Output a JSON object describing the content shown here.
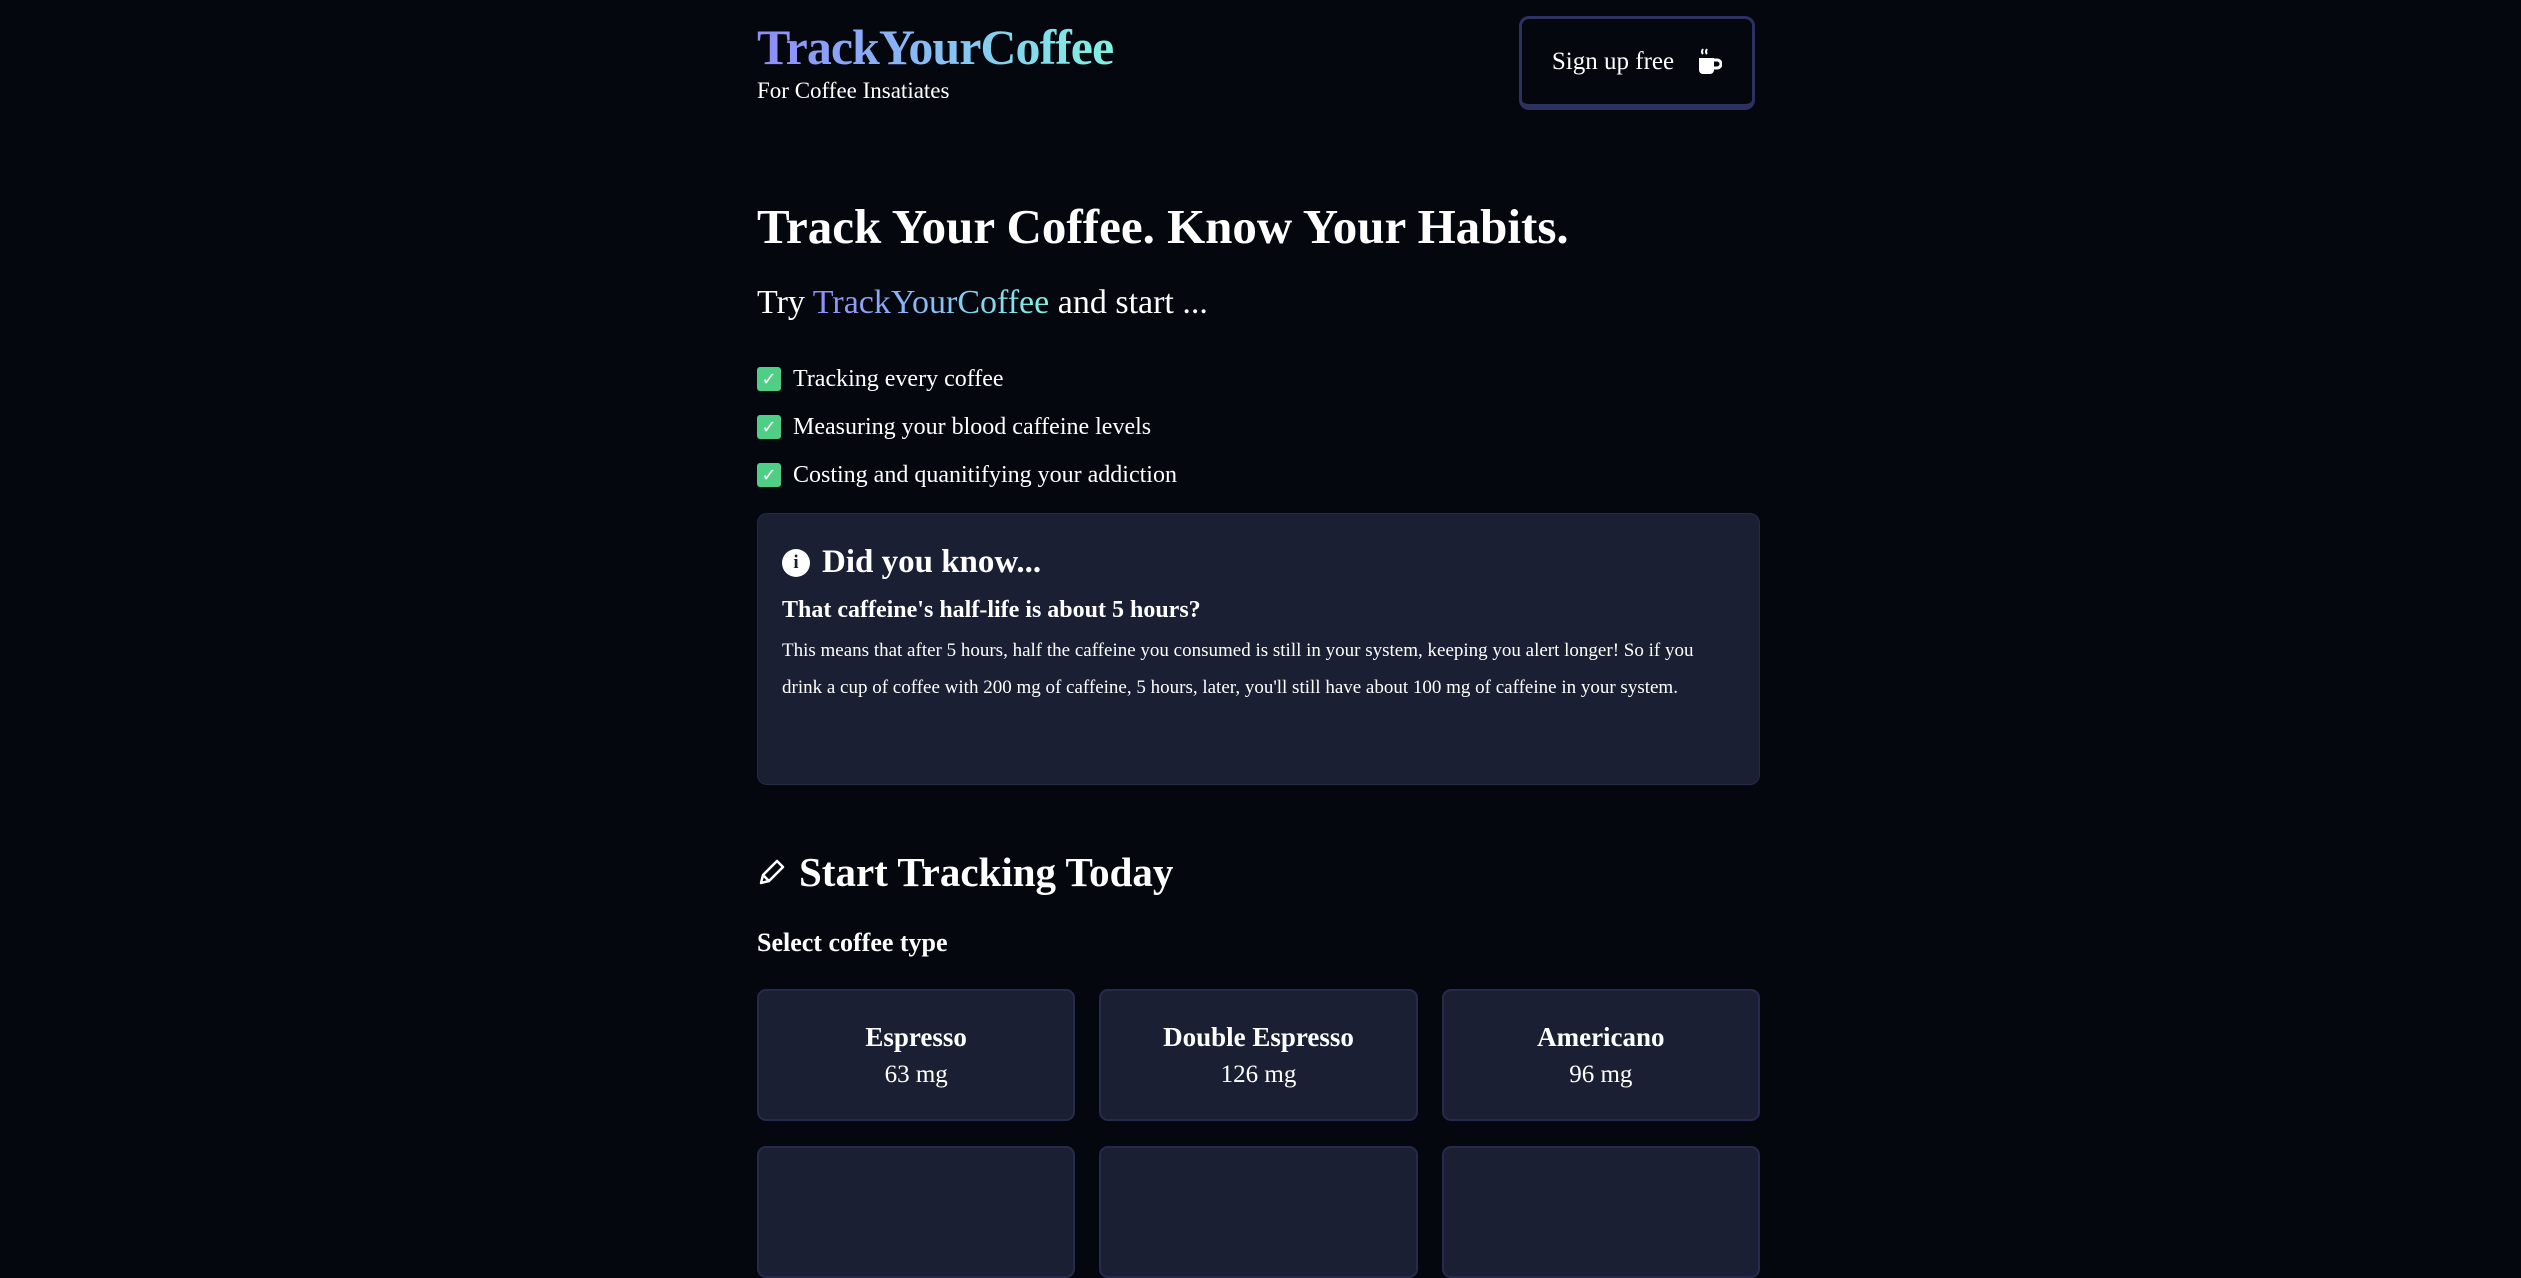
{
  "header": {
    "logo": "TrackYourCoffee",
    "tagline": "For Coffee Insatiates",
    "signup_label": "Sign up free"
  },
  "hero": {
    "title": "Track Your Coffee. Know Your Habits.",
    "try_prefix": "Try",
    "try_brand": "TrackYourCoffee",
    "try_suffix": "and start ...",
    "features": [
      "Tracking every coffee",
      "Measuring your blood caffeine levels",
      "Costing and quanitifying your addiction"
    ]
  },
  "info": {
    "title": "Did you know...",
    "question": "That caffeine's half-life is about 5 hours?",
    "body": "This means that after 5 hours, half the caffeine you consumed is still in your system, keeping you alert longer! So if you drink a cup of coffee with 200 mg of caffeine, 5 hours, later, you'll still have about 100 mg of caffeine in your system."
  },
  "tracking": {
    "title": "Start Tracking Today",
    "select_label": "Select coffee type",
    "coffees": [
      {
        "name": "Espresso",
        "caffeine": "63 mg"
      },
      {
        "name": "Double Espresso",
        "caffeine": "126 mg"
      },
      {
        "name": "Americano",
        "caffeine": "96 mg"
      }
    ]
  }
}
